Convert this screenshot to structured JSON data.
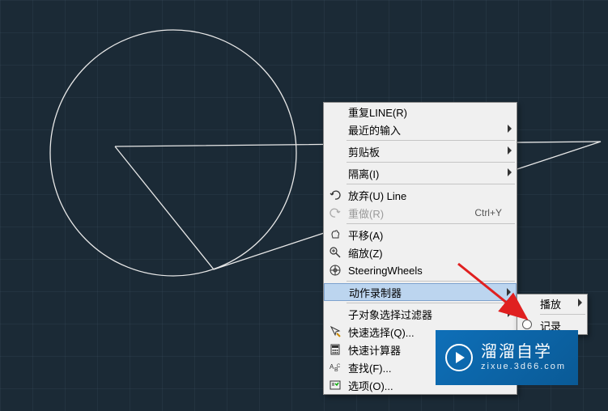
{
  "menu": {
    "repeat": "重复LINE(R)",
    "recentInput": "最近的输入",
    "clipboard": "剪贴板",
    "isolate": "隔离(I)",
    "undo": "放弃(U) Line",
    "redo": "重做(R)",
    "redoKey": "Ctrl+Y",
    "pan": "平移(A)",
    "zoom": "缩放(Z)",
    "wheels": "SteeringWheels",
    "actionRec": "动作录制器",
    "subObjFilter": "子对象选择过滤器",
    "quickSelect": "快速选择(Q)...",
    "quickCalc": "快速计算器",
    "find": "查找(F)...",
    "options": "选项(O)..."
  },
  "submenu": {
    "play": "播放",
    "record": "记录"
  },
  "logo": {
    "title": "溜溜自学",
    "url": "zixue.3d66.com"
  }
}
